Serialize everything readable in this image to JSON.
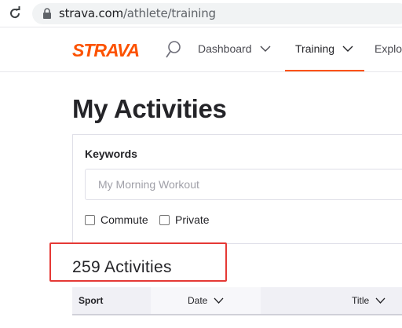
{
  "browser": {
    "url_host": "strava.com",
    "url_path": "/athlete/training"
  },
  "nav": {
    "logo": "STRAVA",
    "items": [
      {
        "label": "Dashboard"
      },
      {
        "label": "Training"
      },
      {
        "label": "Explo"
      }
    ]
  },
  "page": {
    "title": "My Activities"
  },
  "filters": {
    "keywords_label": "Keywords",
    "keywords_placeholder": "My Morning Workout",
    "commute_label": "Commute",
    "private_label": "Private"
  },
  "results": {
    "count_text": "259 Activities"
  },
  "table": {
    "columns": [
      "Sport",
      "Date",
      "Title"
    ]
  },
  "colors": {
    "brand": "#fc5200",
    "highlight": "#e53935"
  }
}
